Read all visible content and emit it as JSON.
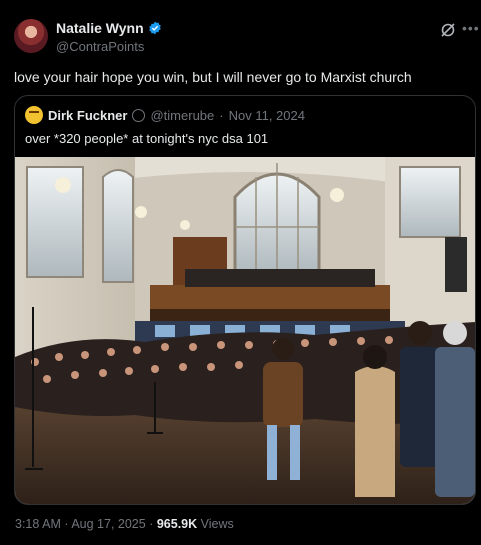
{
  "tweet": {
    "display_name": "Natalie Wynn",
    "handle": "@ContraPoints",
    "text": "love your hair hope you win, but I will never go to Marxist church",
    "time": "3:18 AM",
    "separator": "·",
    "date": "Aug 17, 2025",
    "views_count": "965.9K",
    "views_label": "Views"
  },
  "quote": {
    "display_name": "Dirk Fuckner",
    "handle": "@timerube",
    "separator": "·",
    "date": "Nov 11, 2024",
    "text": "over *320 people* at tonight's nyc dsa 101"
  },
  "icons": {
    "verified": "verified-badge-icon",
    "grok": "grok-icon",
    "more": "more-icon"
  },
  "colors": {
    "background": "#000000",
    "text": "#e7e9ea",
    "muted": "#71767b",
    "verified_blue": "#1d9bf0",
    "border": "#2f3336"
  }
}
